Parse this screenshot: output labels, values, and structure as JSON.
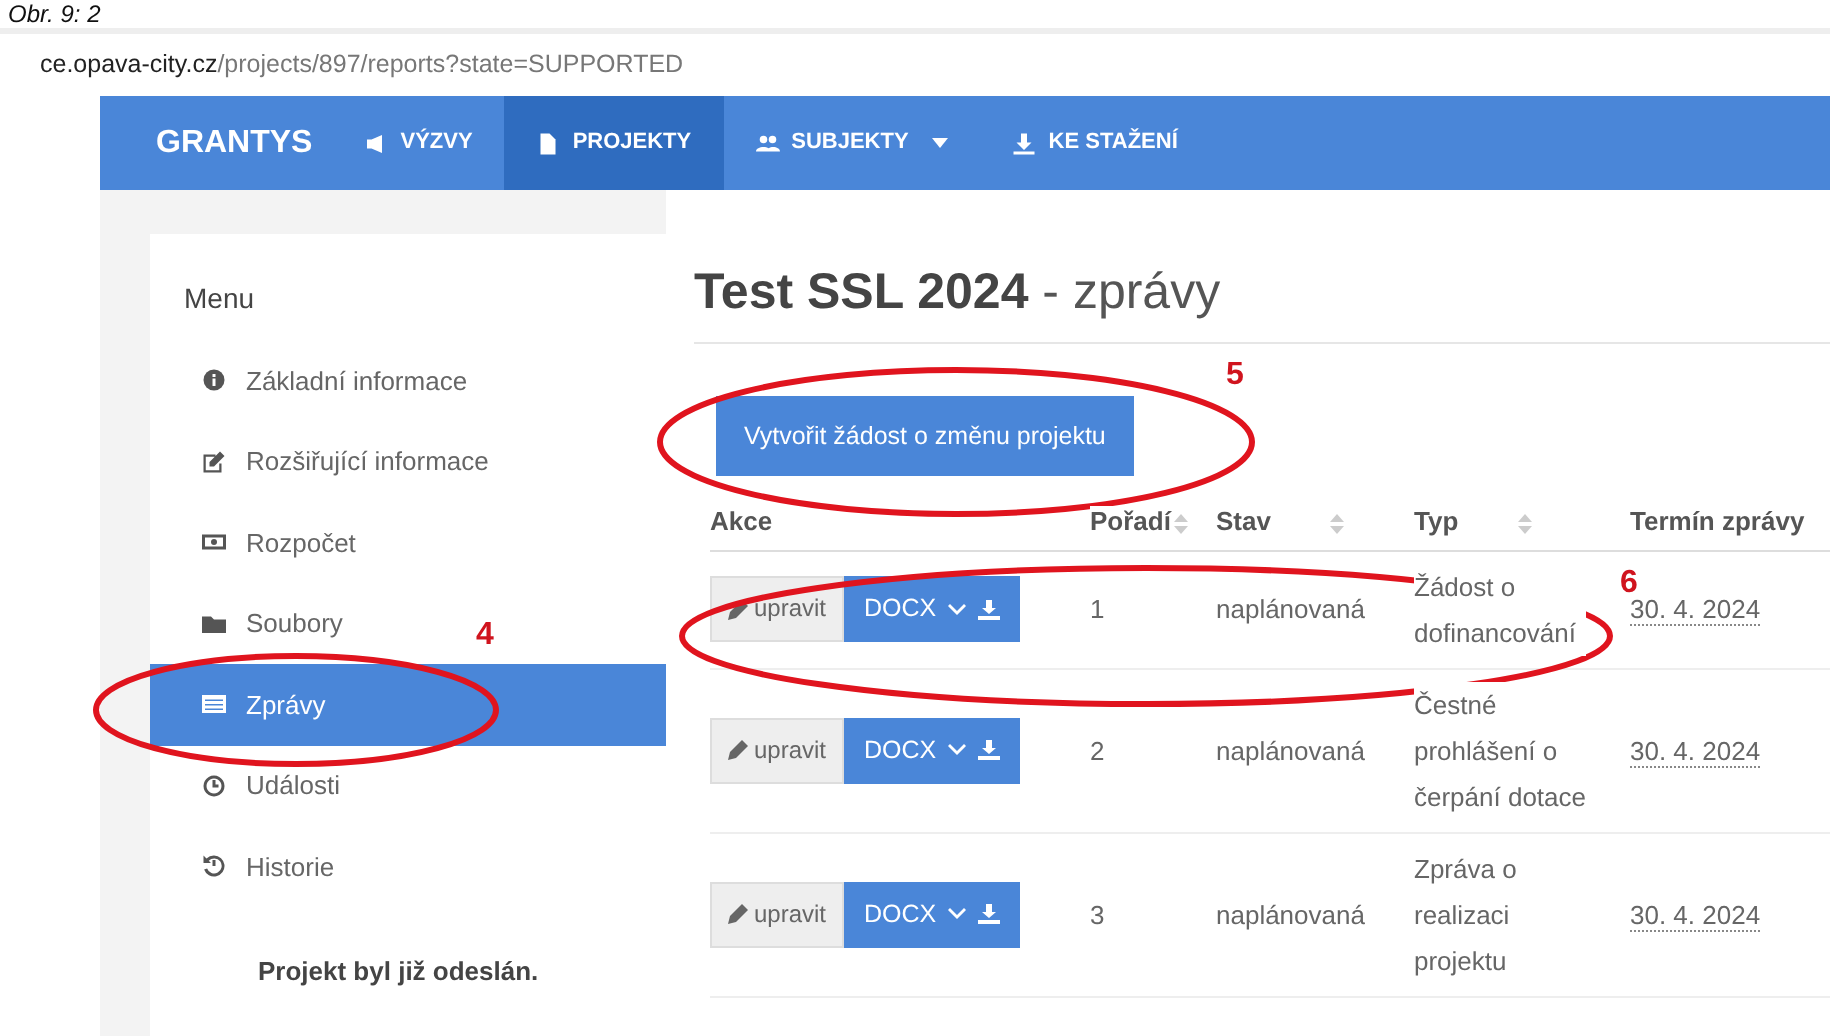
{
  "caption": "Obr. 9: 2",
  "address_bar": {
    "host": "ce.opava-city.cz",
    "path": "/projects/897/reports?state=SUPPORTED"
  },
  "navbar": {
    "brand": "GRANTYS",
    "items": [
      {
        "label": "VÝZVY",
        "selected": false,
        "dropdown": false
      },
      {
        "label": "PROJEKTY",
        "selected": true,
        "dropdown": false
      },
      {
        "label": "SUBJEKTY",
        "selected": false,
        "dropdown": true
      },
      {
        "label": "KE STAŽENÍ",
        "selected": false,
        "dropdown": false
      }
    ]
  },
  "sidebar": {
    "heading": "Menu",
    "items": [
      {
        "label": "Základní informace",
        "selected": false
      },
      {
        "label": "Rozšiřující informace",
        "selected": false
      },
      {
        "label": "Rozpočet",
        "selected": false
      },
      {
        "label": "Soubory",
        "selected": false
      },
      {
        "label": "Zprávy",
        "selected": true
      },
      {
        "label": "Události",
        "selected": false
      },
      {
        "label": "Historie",
        "selected": false
      }
    ],
    "note": "Projekt byl již odeslán."
  },
  "title": "**Test SSL 2024** - zprávy",
  "create_button": "Vytvořit žádost o změnu projektu",
  "table": {
    "columns": [
      {
        "label": "Akce",
        "sortable": false
      },
      {
        "label": "Pořadí",
        "sortable": true
      },
      {
        "label": "Stav",
        "sortable": true
      },
      {
        "label": "Typ",
        "sortable": true
      },
      {
        "label": "Termín zprávy",
        "sortable": false
      }
    ],
    "rows": [
      {
        "edit": "upravit",
        "format": "DOCX",
        "order": "1",
        "state": "naplánovaná",
        "type": "Žádost o dofinancování",
        "deadline": "30. 4. 2024"
      },
      {
        "edit": "upravit",
        "format": "DOCX",
        "order": "2",
        "state": "naplánovaná",
        "type": "Čestné prohlášení o čerpání dotace",
        "deadline": "30. 4. 2024"
      },
      {
        "edit": "upravit",
        "format": "DOCX",
        "order": "3",
        "state": "naplánovaná",
        "type": "Zpráva o realizaci projektu",
        "deadline": "30. 4. 2024"
      }
    ]
  },
  "annotations": [
    {
      "number": "4"
    },
    {
      "number": "5"
    },
    {
      "number": "6"
    }
  ]
}
